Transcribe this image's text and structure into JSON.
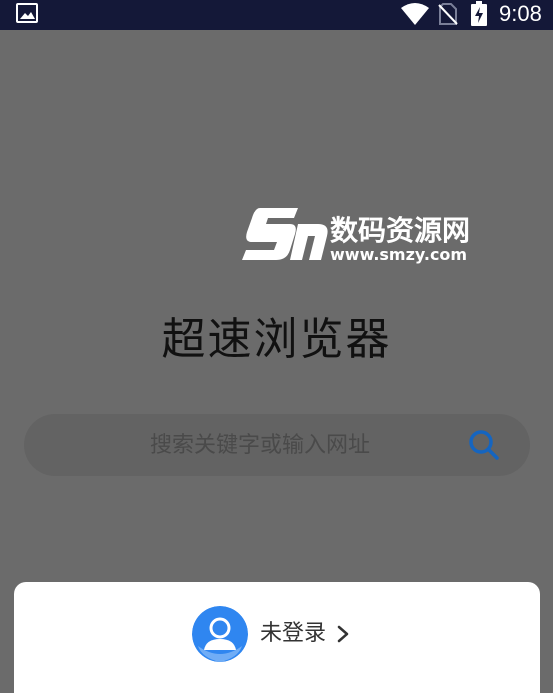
{
  "status_bar": {
    "time": "9:08",
    "icons": [
      "gallery-icon",
      "wifi-icon",
      "no-sim-icon",
      "battery-charging-icon"
    ],
    "background": "#141838"
  },
  "watermark": {
    "logo_text": "数码资源网",
    "url_text": "www.smzy.com"
  },
  "app": {
    "title": "超速浏览器"
  },
  "search": {
    "placeholder": "搜索关键字或输入网址",
    "value": "",
    "icon": "search-icon",
    "icon_color": "#1565c0"
  },
  "account": {
    "login_label": "未登录",
    "avatar_icon": "user-avatar-icon",
    "chevron_icon": "chevron-right-icon",
    "avatar_color": "#2f86f0"
  },
  "colors": {
    "overlay_background": "#6b6b6b",
    "card_background": "#ffffff",
    "title_text": "#111111"
  }
}
